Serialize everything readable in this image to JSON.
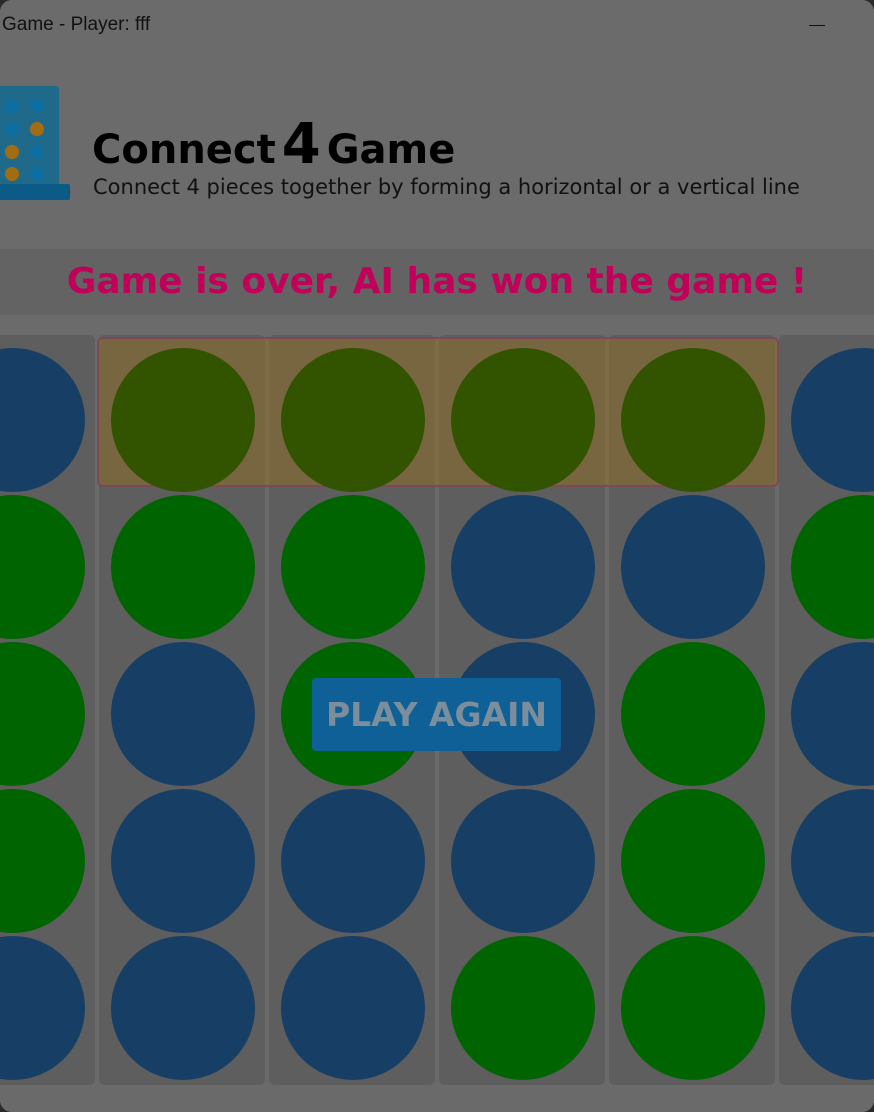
{
  "window": {
    "title": "Game - Player: fff",
    "minimize_icon": "minimize-icon"
  },
  "header": {
    "title_word1": "Connect",
    "title_word2": "4",
    "title_word3": "Game",
    "subtitle": "Connect 4 pieces together by forming a horizontal or a vertical line",
    "logo_icon": "connect-four-logo-icon"
  },
  "status": {
    "message": "Game is over, AI has won the game !",
    "color": "#c1005a"
  },
  "board": {
    "rows": 5,
    "columns_visible": 6,
    "winning_row": 0,
    "grid": [
      [
        "blue",
        "win",
        "win",
        "win",
        "win",
        "blue"
      ],
      [
        "green",
        "green",
        "green",
        "blue",
        "blue",
        "green"
      ],
      [
        "green",
        "blue",
        "green",
        "blue",
        "green",
        "blue"
      ],
      [
        "green",
        "blue",
        "blue",
        "blue",
        "green",
        "blue"
      ],
      [
        "blue",
        "blue",
        "blue",
        "green",
        "green",
        "blue"
      ]
    ],
    "colors": {
      "blue": "#173f66",
      "green": "#006400",
      "win": "#325300"
    }
  },
  "actions": {
    "play_again_label": "PLAY AGAIN"
  }
}
